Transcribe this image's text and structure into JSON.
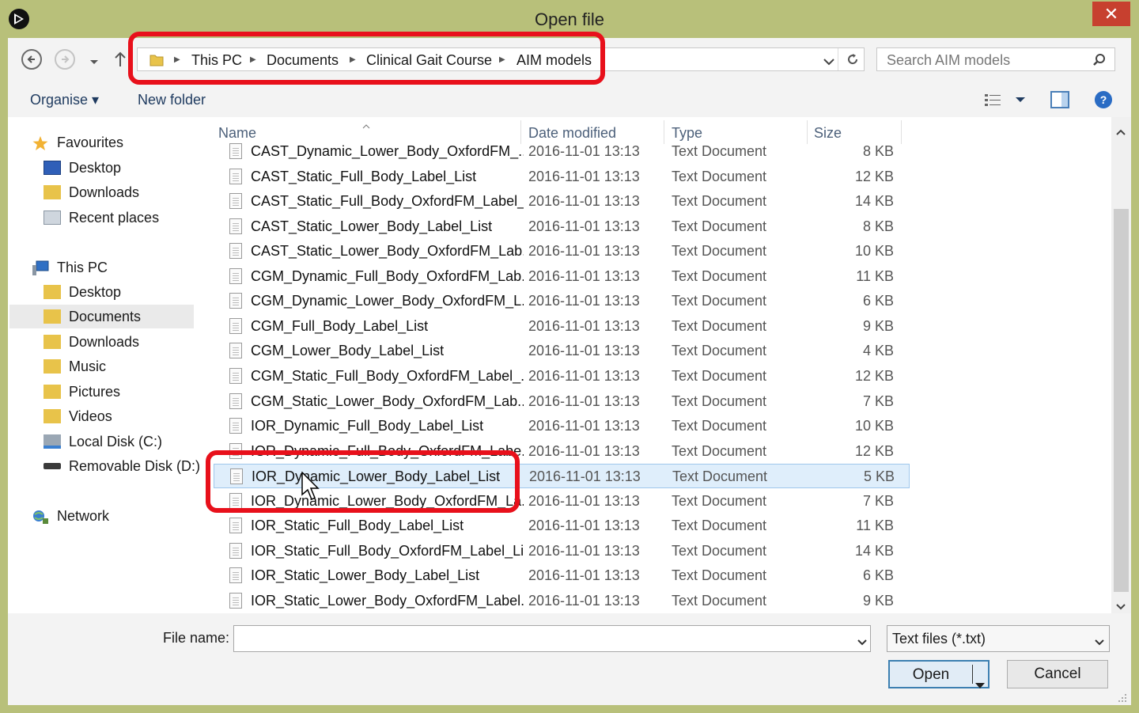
{
  "window": {
    "title": "Open file",
    "close_label": "✕"
  },
  "address": {
    "breadcrumbs": [
      "This PC",
      "Documents",
      "Clinical Gait Course",
      "AIM models"
    ],
    "search_placeholder": "Search AIM models"
  },
  "toolbar": {
    "organise": "Organise ▾",
    "new_folder": "New folder"
  },
  "nav": {
    "favourites": "Favourites",
    "fav_items": [
      "Desktop",
      "Downloads",
      "Recent places"
    ],
    "this_pc": "This PC",
    "pc_items": [
      "Desktop",
      "Documents",
      "Downloads",
      "Music",
      "Pictures",
      "Videos",
      "Local Disk (C:)",
      "Removable Disk (D:)"
    ],
    "network": "Network",
    "selected": "Documents"
  },
  "columns": {
    "name": "Name",
    "date": "Date modified",
    "type": "Type",
    "size": "Size"
  },
  "files": [
    {
      "name": "CAST_Dynamic_Lower_Body_OxfordFM_...",
      "date": "2016-11-01 13:13",
      "type": "Text Document",
      "size": "8 KB"
    },
    {
      "name": "CAST_Static_Full_Body_Label_List",
      "date": "2016-11-01 13:13",
      "type": "Text Document",
      "size": "12 KB"
    },
    {
      "name": "CAST_Static_Full_Body_OxfordFM_Label_...",
      "date": "2016-11-01 13:13",
      "type": "Text Document",
      "size": "14 KB"
    },
    {
      "name": "CAST_Static_Lower_Body_Label_List",
      "date": "2016-11-01 13:13",
      "type": "Text Document",
      "size": "8 KB"
    },
    {
      "name": "CAST_Static_Lower_Body_OxfordFM_Lab...",
      "date": "2016-11-01 13:13",
      "type": "Text Document",
      "size": "10 KB"
    },
    {
      "name": "CGM_Dynamic_Full_Body_OxfordFM_Lab...",
      "date": "2016-11-01 13:13",
      "type": "Text Document",
      "size": "11 KB"
    },
    {
      "name": "CGM_Dynamic_Lower_Body_OxfordFM_L...",
      "date": "2016-11-01 13:13",
      "type": "Text Document",
      "size": "6 KB"
    },
    {
      "name": "CGM_Full_Body_Label_List",
      "date": "2016-11-01 13:13",
      "type": "Text Document",
      "size": "9 KB"
    },
    {
      "name": "CGM_Lower_Body_Label_List",
      "date": "2016-11-01 13:13",
      "type": "Text Document",
      "size": "4 KB"
    },
    {
      "name": "CGM_Static_Full_Body_OxfordFM_Label_...",
      "date": "2016-11-01 13:13",
      "type": "Text Document",
      "size": "12 KB"
    },
    {
      "name": "CGM_Static_Lower_Body_OxfordFM_Lab...",
      "date": "2016-11-01 13:13",
      "type": "Text Document",
      "size": "7 KB"
    },
    {
      "name": "IOR_Dynamic_Full_Body_Label_List",
      "date": "2016-11-01 13:13",
      "type": "Text Document",
      "size": "10 KB"
    },
    {
      "name": "IOR_Dynamic_Full_Body_OxfordFM_Labe...",
      "date": "2016-11-01 13:13",
      "type": "Text Document",
      "size": "12 KB"
    },
    {
      "name": "IOR_Dynamic_Lower_Body_Label_List",
      "date": "2016-11-01 13:13",
      "type": "Text Document",
      "size": "5 KB",
      "selected": true
    },
    {
      "name": "IOR_Dynamic_Lower_Body_OxfordFM_La...",
      "date": "2016-11-01 13:13",
      "type": "Text Document",
      "size": "7 KB"
    },
    {
      "name": "IOR_Static_Full_Body_Label_List",
      "date": "2016-11-01 13:13",
      "type": "Text Document",
      "size": "11 KB"
    },
    {
      "name": "IOR_Static_Full_Body_OxfordFM_Label_List",
      "date": "2016-11-01 13:13",
      "type": "Text Document",
      "size": "14 KB"
    },
    {
      "name": "IOR_Static_Lower_Body_Label_List",
      "date": "2016-11-01 13:13",
      "type": "Text Document",
      "size": "6 KB"
    },
    {
      "name": "IOR_Static_Lower_Body_OxfordFM_Label...",
      "date": "2016-11-01 13:13",
      "type": "Text Document",
      "size": "9 KB"
    }
  ],
  "bottom": {
    "file_name_label": "File name:",
    "file_name_value": "",
    "filter": "Text files (*.txt)",
    "open": "Open",
    "cancel": "Cancel"
  },
  "colors": {
    "highlight": "#e8101b",
    "accent": "#3c7fb1"
  }
}
